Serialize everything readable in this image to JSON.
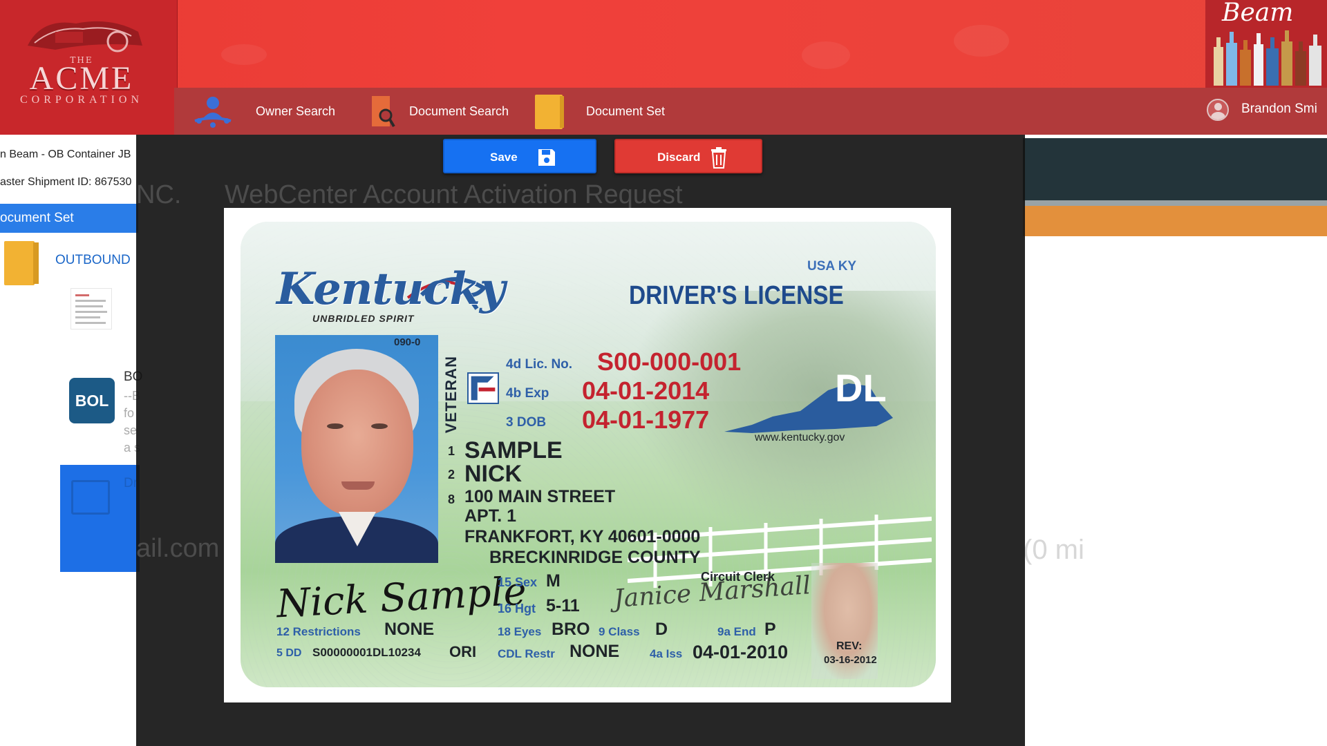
{
  "header": {
    "left_logo": {
      "top_text": "THE",
      "word": "ACME",
      "subword": "CORPORATION"
    },
    "right_logo": {
      "word": "Beam"
    }
  },
  "nav": {
    "owner_search": "Owner Search",
    "document_search": "Document Search",
    "document_set": "Document Set",
    "user_name": "Brandon Smi"
  },
  "left_panel": {
    "info_line_1": "n Beam - OB Container JB",
    "info_line_2": "aster Shipment ID: 867530",
    "docset_header": "ocument Set",
    "outbound_label": "OUTBOUND",
    "bol_badge": "BOL",
    "bol_title": "BO",
    "bol_desc": "--B fo se a s",
    "active_doc_title": "Dr"
  },
  "background_text": {
    "company": "NC.",
    "request_title": "WebCenter Account Activation Request",
    "email_fragment": "ail.com",
    "right_fragment": "(0 mi"
  },
  "modal": {
    "save_label": "Save",
    "discard_label": "Discard"
  },
  "license": {
    "state_word": "Kentucky",
    "tagline": "UNBRIDLED SPIRIT",
    "country_state": "USA KY",
    "title": "DRIVER'S LICENSE",
    "photo_code": "090-0",
    "veteran": "VETERAN",
    "lic_no_label": "4d Lic. No.",
    "lic_no": "S00-000-001",
    "exp_label": "4b Exp",
    "exp": "04-01-2014",
    "dob_label": "3  DOB",
    "dob": "04-01-1977",
    "dl_badge": "DL",
    "url": "www.kentucky.gov",
    "field1_num": "1",
    "last_name": "SAMPLE",
    "field2_num": "2",
    "first_name": "NICK",
    "field8_num": "8",
    "address_1": "100 MAIN STREET",
    "address_2": "APT. 1",
    "address_3": "FRANKFORT, KY 40601-0000",
    "county": "BRECKINRIDGE COUNTY",
    "circuit_clerk": "Circuit Clerk",
    "holder_signature": "Nick Sample",
    "clerk_signature": "Janice Marshall",
    "sex_label": "15 Sex",
    "sex": "M",
    "hgt_label": "16 Hgt",
    "hgt": "5-11",
    "restrictions_label": "12 Restrictions",
    "restrictions": "NONE",
    "eyes_label": "18 Eyes",
    "eyes": "BRO",
    "class_label": "9 Class",
    "class": "D",
    "end_label": "9a End",
    "end": "P",
    "dd_label": "5 DD",
    "dd": "S00000001DL10234",
    "ori": "ORI",
    "cdl_label": "CDL Restr",
    "cdl": "NONE",
    "iss_label": "4a Iss",
    "iss": "04-01-2010",
    "rev_label": "REV:",
    "rev_date": "03-16-2012"
  },
  "colors": {
    "header_red": "#e83b34",
    "nav_red": "#b13a3b",
    "save_blue": "#1671f2",
    "discard_red": "#e03a34",
    "docset_blue": "#2a7de8",
    "license_red": "#c4232f",
    "license_blue": "#2e5fa8"
  },
  "icons": {
    "owner_search": "person-search-icon",
    "document_search": "document-magnifier-icon",
    "document_set": "folder-icon",
    "user": "user-avatar-icon",
    "save": "floppy-disk-icon",
    "discard": "trash-icon"
  }
}
